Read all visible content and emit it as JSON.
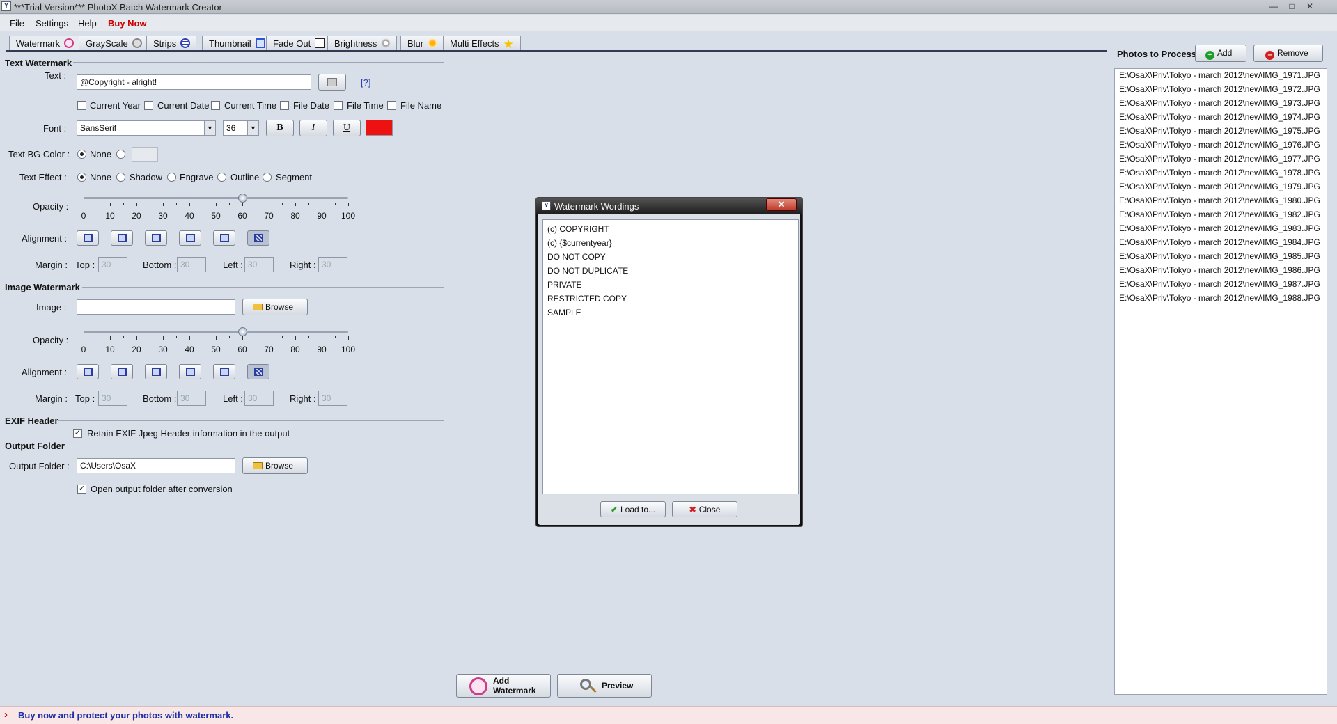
{
  "window": {
    "title": "***Trial Version*** PhotoX Batch Watermark Creator"
  },
  "menu": {
    "file": "File",
    "settings": "Settings",
    "help": "Help",
    "buy_now": "Buy Now"
  },
  "tabs": [
    "Watermark",
    "GrayScale",
    "Strips",
    "Thumbnail",
    "Fade Out",
    "Brightness",
    "Blur",
    "Multi Effects"
  ],
  "text_watermark": {
    "section": "Text Watermark",
    "text_label": "Text :",
    "text_value": "@Copyright - alright!",
    "help_link": "[?]",
    "checkboxes": [
      "Current Year",
      "Current Date",
      "Current Time",
      "File Date",
      "File Time",
      "File Name"
    ],
    "font_label": "Font :",
    "font_value": "SansSerif",
    "size_value": "36",
    "bold": "B",
    "italic": "I",
    "underline": "U",
    "color": "#ee1111",
    "bg_label": "Text BG Color :",
    "bg_none": "None",
    "effect_label": "Text Effect :",
    "effects": [
      "None",
      "Shadow",
      "Engrave",
      "Outline",
      "Segment"
    ],
    "opacity_label": "Opacity :",
    "opacity": 60,
    "alignment_label": "Alignment :",
    "margin_label": "Margin :",
    "margins": [
      {
        "label": "Top :",
        "value": "30"
      },
      {
        "label": "Bottom :",
        "value": "30"
      },
      {
        "label": "Left :",
        "value": "30"
      },
      {
        "label": "Right :",
        "value": "30"
      }
    ]
  },
  "image_watermark": {
    "section": "Image Watermark",
    "image_label": "Image :",
    "image_value": "",
    "browse": "Browse",
    "opacity_label": "Opacity :",
    "opacity": 60,
    "alignment_label": "Alignment :",
    "margin_label": "Margin :",
    "margins": [
      {
        "label": "Top :",
        "value": "30"
      },
      {
        "label": "Bottom :",
        "value": "30"
      },
      {
        "label": "Left :",
        "value": "30"
      },
      {
        "label": "Right :",
        "value": "30"
      }
    ]
  },
  "ticks": [
    "0",
    "10",
    "20",
    "30",
    "40",
    "50",
    "60",
    "70",
    "80",
    "90",
    "100"
  ],
  "exif": {
    "section": "EXIF Header",
    "retain": "Retain EXIF Jpeg Header information in the output"
  },
  "output": {
    "section": "Output Folder",
    "label": "Output Folder :",
    "value": "C:\\Users\\OsaX",
    "browse": "Browse",
    "open_after": "Open output folder after conversion"
  },
  "actions": {
    "add_watermark_1": "Add",
    "add_watermark_2": "Watermark",
    "preview": "Preview"
  },
  "status": {
    "text": "Buy now and protect your photos with watermark."
  },
  "photos": {
    "title": "Photos to Process",
    "add": "Add",
    "remove": "Remove",
    "items": [
      "E:\\OsaX\\Priv\\Tokyo - march 2012\\new\\IMG_1971.JPG",
      "E:\\OsaX\\Priv\\Tokyo - march 2012\\new\\IMG_1972.JPG",
      "E:\\OsaX\\Priv\\Tokyo - march 2012\\new\\IMG_1973.JPG",
      "E:\\OsaX\\Priv\\Tokyo - march 2012\\new\\IMG_1974.JPG",
      "E:\\OsaX\\Priv\\Tokyo - march 2012\\new\\IMG_1975.JPG",
      "E:\\OsaX\\Priv\\Tokyo - march 2012\\new\\IMG_1976.JPG",
      "E:\\OsaX\\Priv\\Tokyo - march 2012\\new\\IMG_1977.JPG",
      "E:\\OsaX\\Priv\\Tokyo - march 2012\\new\\IMG_1978.JPG",
      "E:\\OsaX\\Priv\\Tokyo - march 2012\\new\\IMG_1979.JPG",
      "E:\\OsaX\\Priv\\Tokyo - march 2012\\new\\IMG_1980.JPG",
      "E:\\OsaX\\Priv\\Tokyo - march 2012\\new\\IMG_1982.JPG",
      "E:\\OsaX\\Priv\\Tokyo - march 2012\\new\\IMG_1983.JPG",
      "E:\\OsaX\\Priv\\Tokyo - march 2012\\new\\IMG_1984.JPG",
      "E:\\OsaX\\Priv\\Tokyo - march 2012\\new\\IMG_1985.JPG",
      "E:\\OsaX\\Priv\\Tokyo - march 2012\\new\\IMG_1986.JPG",
      "E:\\OsaX\\Priv\\Tokyo - march 2012\\new\\IMG_1987.JPG",
      "E:\\OsaX\\Priv\\Tokyo - march 2012\\new\\IMG_1988.JPG"
    ]
  },
  "dialog": {
    "title": "Watermark Wordings",
    "items": [
      "(c) COPYRIGHT",
      "(c) {$currentyear}",
      "DO NOT COPY",
      "DO NOT DUPLICATE",
      "PRIVATE",
      "RESTRICTED COPY",
      "SAMPLE"
    ],
    "load": "Load to...",
    "close": "Close"
  }
}
